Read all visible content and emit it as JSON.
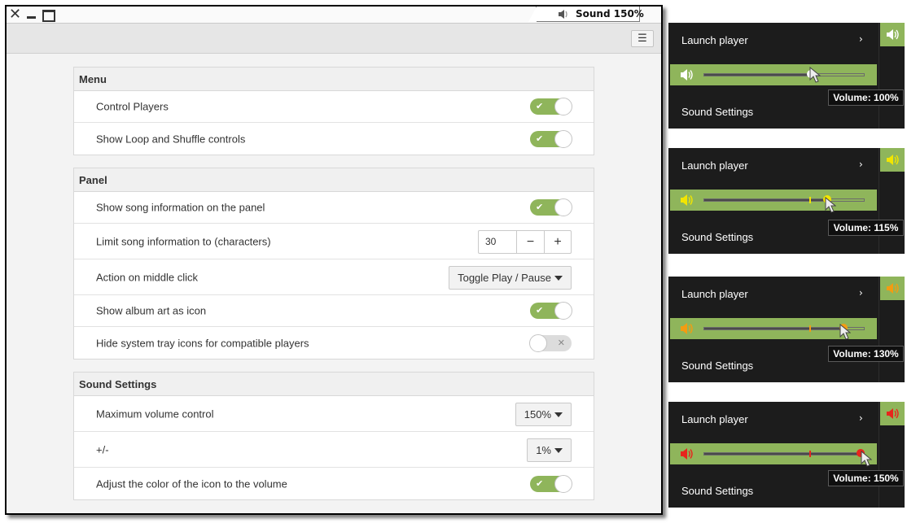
{
  "titlebar": {
    "sound_tab_label": "Sound 150%"
  },
  "menu_button_glyph": "☰",
  "sections": {
    "menu": {
      "title": "Menu",
      "rows": [
        {
          "label": "Control Players",
          "type": "switch",
          "value": true
        },
        {
          "label": "Show Loop and Shuffle controls",
          "type": "switch",
          "value": true
        }
      ]
    },
    "panel": {
      "title": "Panel",
      "rows": [
        {
          "label": "Show song information on the panel",
          "type": "switch",
          "value": true
        },
        {
          "label": "Limit song information to (characters)",
          "type": "spinner",
          "value": "30",
          "minus": "−",
          "plus": "+"
        },
        {
          "label": "Action on middle click",
          "type": "dropdown",
          "value": "Toggle Play / Pause"
        },
        {
          "label": "Show album art as icon",
          "type": "switch",
          "value": true
        },
        {
          "label": "Hide system tray icons for compatible players",
          "type": "switch",
          "value": false
        }
      ]
    },
    "sound_settings": {
      "title": "Sound Settings",
      "rows": [
        {
          "label": "Maximum volume control",
          "type": "dropdown",
          "value": "150%"
        },
        {
          "label": "+/-",
          "type": "dropdown",
          "value": "1%"
        },
        {
          "label": "Adjust the color of the icon to the volume",
          "type": "switch",
          "value": true
        }
      ]
    }
  },
  "switch_marks": {
    "on": "✔",
    "off": "✕"
  },
  "colors": {
    "accent_green": "#8fb55b",
    "popup_bg": "#1c1c1c",
    "volume_100": "#ffffff",
    "volume_115": "#f2e500",
    "volume_130": "#f39c12",
    "volume_150": "#e8251c"
  },
  "popups": [
    {
      "launch_label": "Launch player",
      "chevron": "›",
      "settings_label": "Sound Settings",
      "tooltip": "Volume: 100%",
      "volume_fraction_of_max": 0.667,
      "icon_color": "#ffffff",
      "speaker_icon": "speaker-icon"
    },
    {
      "launch_label": "Launch player",
      "chevron": "›",
      "settings_label": "Sound Settings",
      "tooltip": "Volume: 115%",
      "volume_fraction_of_max": 0.767,
      "icon_color": "#f2e500",
      "speaker_icon": "speaker-icon"
    },
    {
      "launch_label": "Launch player",
      "chevron": "›",
      "settings_label": "Sound Settings",
      "tooltip": "Volume: 130%",
      "volume_fraction_of_max": 0.867,
      "icon_color": "#f39c12",
      "speaker_icon": "speaker-icon"
    },
    {
      "launch_label": "Launch player",
      "chevron": "›",
      "settings_label": "Sound Settings",
      "tooltip": "Volume: 150%",
      "volume_fraction_of_max": 1.0,
      "icon_color": "#e8251c",
      "speaker_icon": "speaker-icon"
    }
  ]
}
